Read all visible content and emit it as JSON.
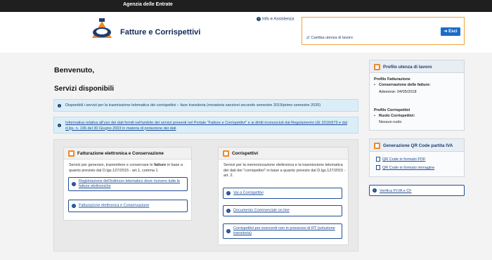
{
  "topbar": {
    "brand": "Agenzia delle Entrate"
  },
  "header": {
    "app_title": "Fatture e Corrispettivi",
    "info_link": "Info e Assistenza",
    "change_user": "Cambia utenza di lavoro",
    "exit_button": "Esci"
  },
  "main": {
    "welcome": "Benvenuto,",
    "services_title": "Servizi disponibili",
    "alerts": [
      "Disponibili i servizi per la trasmissione telematica dei corrispettivi – fase transitoria (moratoria sanzioni secondo semestre 2019/primo semestre 2020)",
      "Informativa relativa all'uso dei dati forniti nell'ambito dei servizi presenti nel Portale \"Fatture e Corrispettivi\" e ai diritti riconosciuti dal Regolamento UE 2016/679 e dal d.lgs. n. 196 del 30 Giugno 2003 in materia di protezione dei dati"
    ],
    "cards": {
      "left": {
        "title": "Fatturazione elettronica e Conservazione",
        "desc_pre": "Servizi per generare, trasmettere e conservare le ",
        "desc_bold": "fatture",
        "desc_post": " in base a quanto previsto dal D.lgs.127/2015 - art.1, comma 1",
        "links": [
          "Registrazione dell'indirizzo telematico dove ricevere tutte le fatture elettroniche",
          "Fatturazione elettronica e Conservazione"
        ]
      },
      "right": {
        "title": "Corrispettivi",
        "desc": "Servizi per la memorizzazione elettronica e la trasmissione telematica dei dati dei \"corrispettivi\" in base a quanto previsto dal D.lgs.127/2015 - art. 2.",
        "links": [
          "Vai a Corrispettivi",
          "Documento Commerciale on line",
          "Corrispettivi per esercenti non in possesso di RT (soluzione transitoria)"
        ]
      }
    }
  },
  "sidebar": {
    "profile": {
      "title": "Profilo utenza di lavoro",
      "fatturazione_label": "Profilo Fatturazione",
      "conservazione_label": "Conservazione delle fatture:",
      "conservazione_value": "Adesione: 04/05/2018",
      "corrispettivi_label": "Profilo Corrispettivi",
      "ruolo_label": "Ruolo Corrispettivi:",
      "ruolo_value": "Nessun ruolo"
    },
    "qr": {
      "title": "Generazione QR Code partita IVA",
      "links": [
        "QR Code in formato PDF",
        "QR Code in formato immagine"
      ]
    },
    "verify_button": "Verifica P.IVA e CF"
  },
  "colors": {
    "accent_orange": "#f0892b",
    "link_blue": "#1f4e96",
    "button_blue": "#1a6cc9",
    "alert_bg": "#dbeef8"
  }
}
